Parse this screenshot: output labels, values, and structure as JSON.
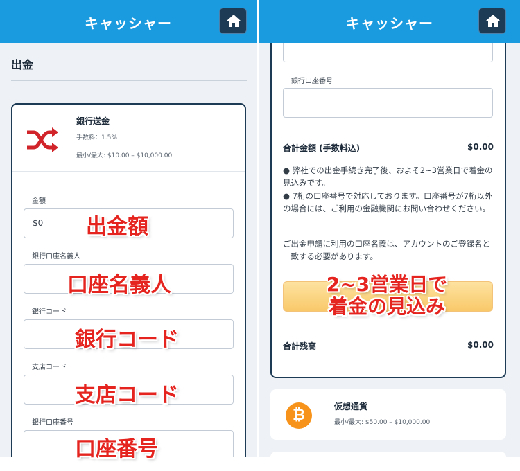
{
  "app": {
    "title": "キャッシャー"
  },
  "left": {
    "section_title": "出金",
    "method": {
      "name": "銀行送金",
      "fee": "手数料：1.5%",
      "limits": "最小/最大: $10.00 – $10,000.00"
    },
    "fields": [
      {
        "label": "金額",
        "value": "$0"
      },
      {
        "label": "銀行口座名義人",
        "value": ""
      },
      {
        "label": "銀行コード",
        "value": ""
      },
      {
        "label": "支店コード",
        "value": ""
      },
      {
        "label": "銀行口座番号",
        "value": ""
      }
    ],
    "overlays": [
      "出金額",
      "口座名義人",
      "銀行コード",
      "支店コード",
      "口座番号"
    ]
  },
  "right": {
    "account_number_label": "銀行口座番号",
    "total_label": "合計金額 (手数料込)",
    "total_value": "$0.00",
    "notes": [
      "● 弊社での出金手続き完了後、およそ2~3営業日で着金の見込みです。",
      "● 7桁の口座番号で対応しております。口座番号が7桁以外の場合には、ご利用の金融機関にお問い合わせください。"
    ],
    "name_note": "ご出金申請に利用の口座名義は、アカウントのご登録名と一致する必要があります。",
    "submit_overlay_line1": "2~3営業日で",
    "submit_overlay_line2": "着金の見込み",
    "balance_label": "合計残高",
    "balance_value": "$0.00",
    "crypto": {
      "name": "仮想通貨",
      "limits": "最小/最大: $50.00 – $10,000.00"
    }
  },
  "colors": {
    "header": "#1a9be0",
    "home_button": "#1d3b55",
    "overlay_text": "#e5241f",
    "bitcoin": "#f7931a",
    "shuffle_icon": "#d0232a"
  },
  "icons": {
    "home": "home-icon",
    "bank_transfer": "shuffle-arrows-icon",
    "crypto": "bitcoin-icon"
  }
}
